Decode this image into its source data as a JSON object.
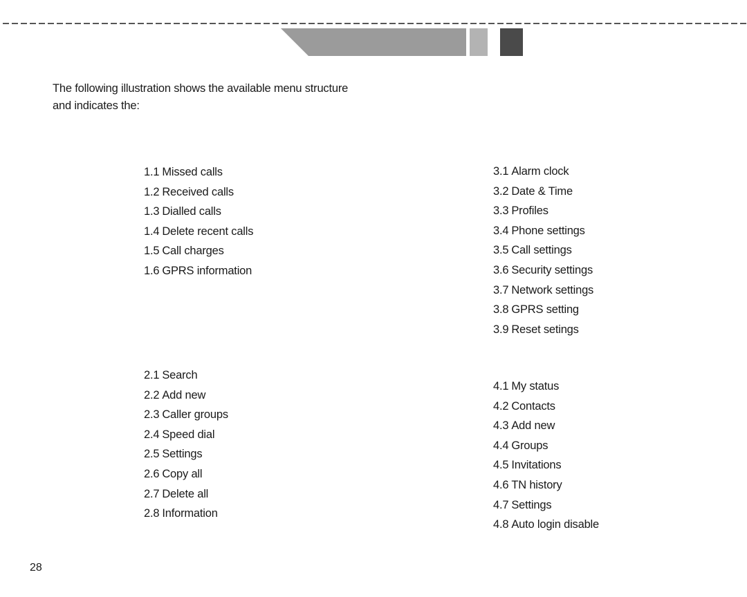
{
  "header": {
    "decoration": "dashed-rule-with-gray-tab-blocks"
  },
  "intro_text": "The following illustration shows the available menu structure and indicates the:",
  "menus": [
    {
      "id": "menu-1",
      "items": [
        {
          "num": "1.1",
          "label": "Missed calls"
        },
        {
          "num": "1.2",
          "label": "Received calls"
        },
        {
          "num": "1.3",
          "label": "Dialled calls"
        },
        {
          "num": "1.4",
          "label": "Delete recent calls"
        },
        {
          "num": "1.5",
          "label": "Call charges"
        },
        {
          "num": "1.6",
          "label": "GPRS information"
        }
      ]
    },
    {
      "id": "menu-2",
      "items": [
        {
          "num": "2.1",
          "label": "Search"
        },
        {
          "num": "2.2",
          "label": "Add new"
        },
        {
          "num": "2.3",
          "label": "Caller groups"
        },
        {
          "num": "2.4",
          "label": "Speed dial"
        },
        {
          "num": "2.5",
          "label": "Settings"
        },
        {
          "num": "2.6",
          "label": "Copy all"
        },
        {
          "num": "2.7",
          "label": "Delete all"
        },
        {
          "num": "2.8",
          "label": "Information"
        }
      ]
    },
    {
      "id": "menu-3",
      "items": [
        {
          "num": "3.1",
          "label": "Alarm clock"
        },
        {
          "num": "3.2",
          "label": "Date & Time"
        },
        {
          "num": "3.3",
          "label": "Profiles"
        },
        {
          "num": "3.4",
          "label": "Phone settings"
        },
        {
          "num": "3.5",
          "label": "Call settings"
        },
        {
          "num": "3.6",
          "label": "Security settings"
        },
        {
          "num": "3.7",
          "label": "Network settings"
        },
        {
          "num": "3.8",
          "label": "GPRS setting"
        },
        {
          "num": "3.9",
          "label": "Reset setings"
        }
      ]
    },
    {
      "id": "menu-4",
      "items": [
        {
          "num": "4.1",
          "label": "My status"
        },
        {
          "num": "4.2",
          "label": "Contacts"
        },
        {
          "num": "4.3",
          "label": "Add new"
        },
        {
          "num": "4.4",
          "label": "Groups"
        },
        {
          "num": "4.5",
          "label": "Invitations"
        },
        {
          "num": "4.6",
          "label": "TN history"
        },
        {
          "num": "4.7",
          "label": "Settings"
        },
        {
          "num": "4.8",
          "label": "Auto login disable"
        }
      ]
    }
  ],
  "footer": {
    "page_number": "28"
  }
}
